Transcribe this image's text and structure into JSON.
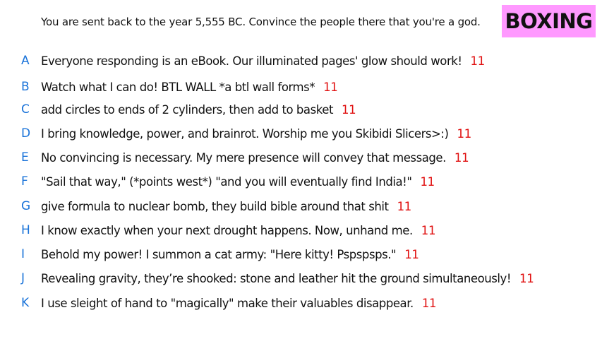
{
  "prompt": "You are sent back to the year 5,555 BC. Convince the people there that you're a god.",
  "badge": {
    "label": "BOXING",
    "color": "#ff99ff"
  },
  "colors": {
    "letter": "#1a73d9",
    "score": "#e01010"
  },
  "answers": [
    {
      "letter": "A",
      "text": "Everyone responding is an eBook. Our illuminated pages' glow should work!",
      "score": "11"
    },
    {
      "letter": "B",
      "text": "Watch what I can do! BTL WALL *a btl wall forms*",
      "score": "11"
    },
    {
      "letter": "C",
      "text": "add circles to ends of 2 cylinders, then add to basket",
      "score": "11"
    },
    {
      "letter": "D",
      "text": "I bring knowledge, power, and brainrot. Worship me you Skibidi Slicers>:)",
      "score": "11"
    },
    {
      "letter": "E",
      "text": "No convincing is necessary. My mere presence will convey that message.",
      "score": "11"
    },
    {
      "letter": "F",
      "text": "\"Sail that way,\" (*points west*) \"and you will eventually find India!\"",
      "score": "11"
    },
    {
      "letter": "G",
      "text": "give formula to nuclear bomb, they build bible around that shit",
      "score": "11"
    },
    {
      "letter": "H",
      "text": "I know exactly when your next drought happens. Now, unhand me.",
      "score": "11"
    },
    {
      "letter": "I",
      "text": "Behold my power! I summon a cat army: \"Here kitty! Pspspsps.\"",
      "score": "11"
    },
    {
      "letter": "J",
      "text": "Revealing gravity, they’re shooked: stone and leather hit the ground simultaneously!",
      "score": "11"
    },
    {
      "letter": "K",
      "text": "I use sleight of hand to \"magically\" make their valuables disappear.",
      "score": "11"
    }
  ]
}
